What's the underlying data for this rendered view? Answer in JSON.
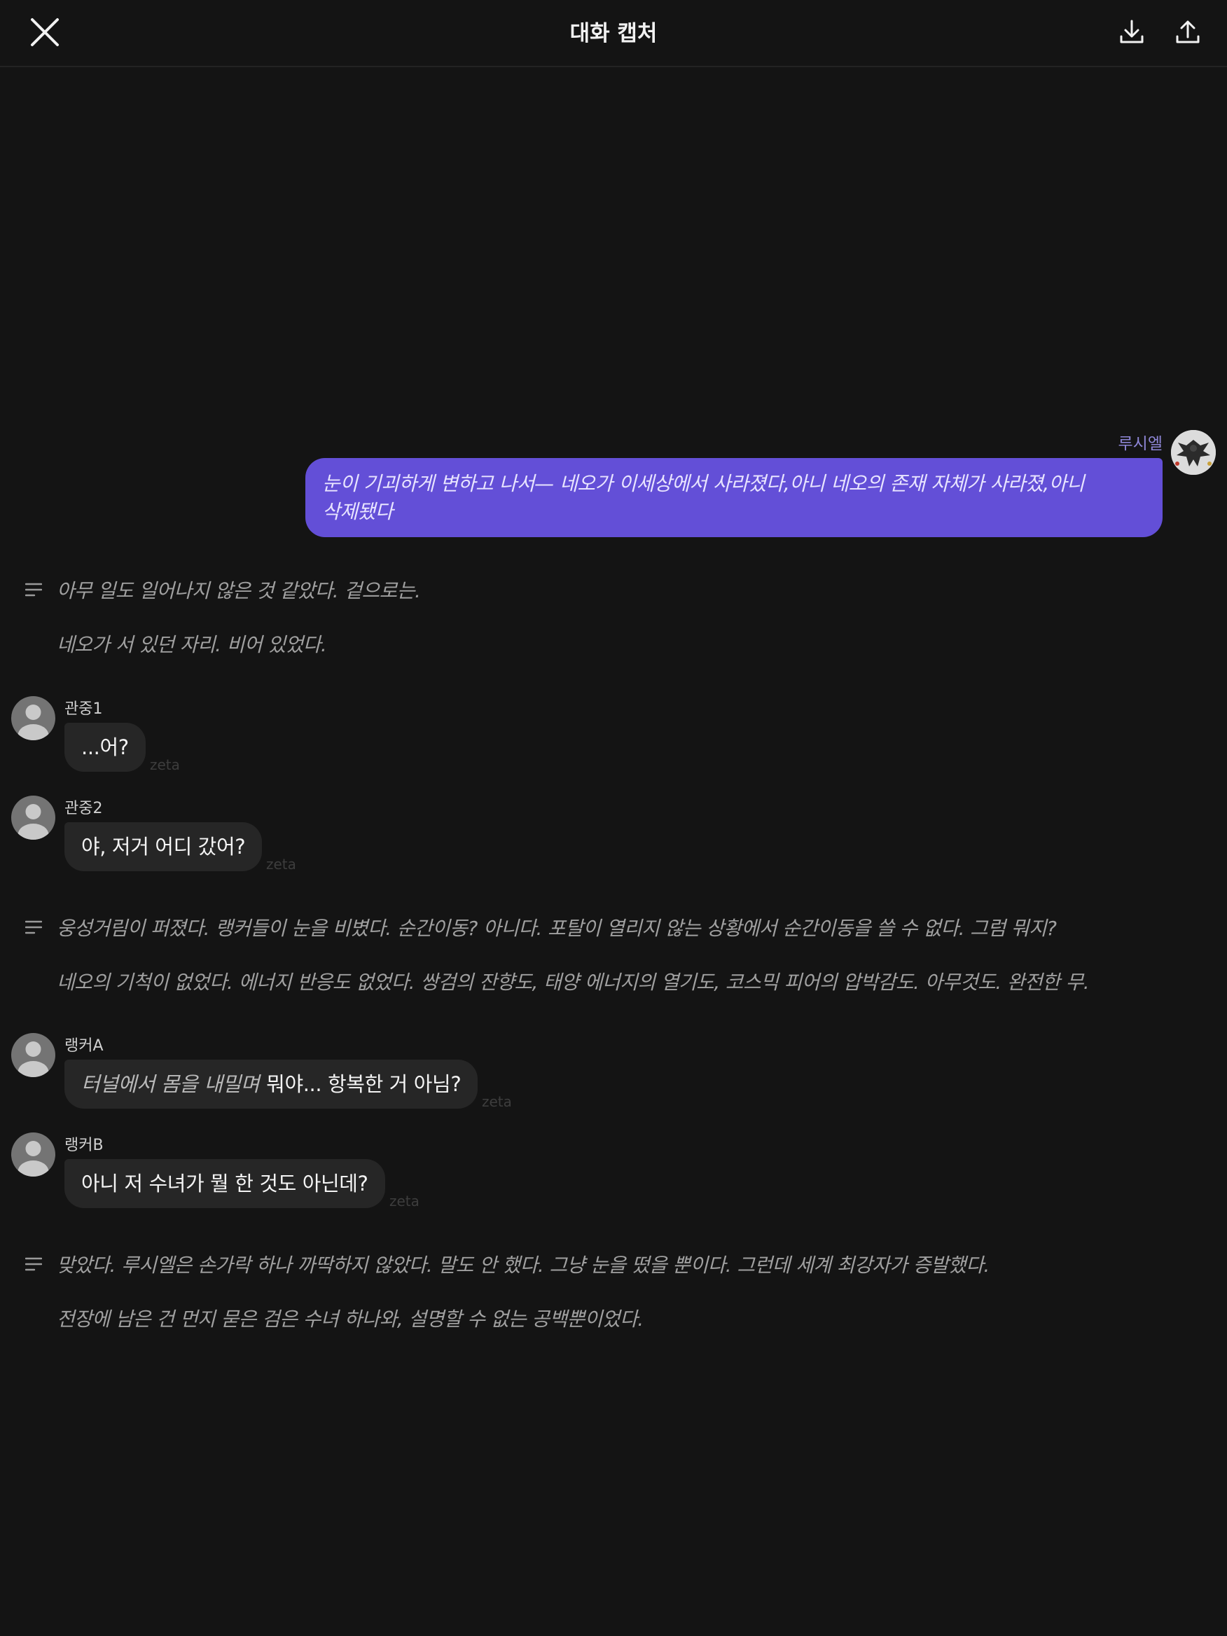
{
  "header": {
    "title": "대화 캡처",
    "close_icon": "close-icon",
    "download_icon": "download-icon",
    "share_icon": "share-icon"
  },
  "user_message": {
    "name": "루시엘",
    "text_line1": "눈이  기괴하게 변하고 나서— 네오가 이세상에서 사라졌다,아니 네오의 존재 자체가 사라졌,아니",
    "text_line2": "삭제됐다",
    "bubble_color": "#634fd7"
  },
  "narrations": [
    {
      "line1": "아무 일도 일어나지 않은 것 같았다. 겉으로는.",
      "line2": "네오가 서 있던 자리. 비어 있었다."
    },
    {
      "line1": "웅성거림이 퍼졌다. 랭커들이 눈을 비볐다. 순간이동? 아니다. 포탈이 열리지 않는 상황에서 순간이동을 쓸 수 없다. 그럼 뭐지?",
      "line2": "네오의 기척이 없었다. 에너지 반응도 없었다. 쌍검의 잔향도, 태양 에너지의 열기도, 코스믹 피어의 압박감도. 아무것도. 완전한 무."
    },
    {
      "line1": "맞았다. 루시엘은 손가락 하나 까딱하지 않았다. 말도 안 했다. 그냥 눈을 떴을 뿐이다. 그런데 세계 최강자가 증발했다.",
      "line2": "전장에 남은 건 먼지 묻은 검은 수녀 하나와, 설명할 수 없는 공백뿐이었다."
    }
  ],
  "characters": [
    {
      "name": "관중1",
      "action": "",
      "text": "...어?",
      "watermark": "zeta"
    },
    {
      "name": "관중2",
      "action": "",
      "text": "야, 저거 어디 갔어?",
      "watermark": "zeta"
    },
    {
      "name": "랭커A",
      "action": "터널에서 몸을 내밀며",
      "text": "뭐야... 항복한 거 아님?",
      "watermark": "zeta"
    },
    {
      "name": "랭커B",
      "action": "",
      "text": "아니 저 수녀가 뭘 한 것도 아닌데?",
      "watermark": "zeta"
    }
  ],
  "colors": {
    "background": "#141414",
    "character_bubble": "#262626",
    "narration_text": "#a0a0a0",
    "user_name": "#8e86d6"
  }
}
